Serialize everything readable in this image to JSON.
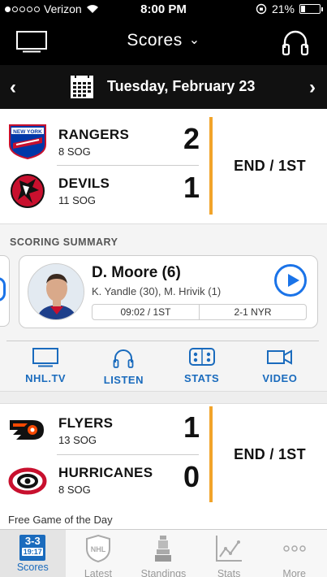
{
  "status_bar": {
    "carrier": "Verizon",
    "time": "8:00 PM",
    "battery": "21%",
    "battery_level": 0.21
  },
  "header": {
    "title": "Scores",
    "left_icon": "tv-icon",
    "right_icon": "headphones-icon"
  },
  "date_bar": {
    "date": "Tuesday, February 23",
    "prev_icon": "chevron-left-icon",
    "next_icon": "chevron-right-icon"
  },
  "games": [
    {
      "status": "END / 1ST",
      "teams": [
        {
          "name": "RANGERS",
          "sog": "8 SOG",
          "score": "2",
          "logo": "rangers-logo"
        },
        {
          "name": "DEVILS",
          "sog": "11 SOG",
          "score": "1",
          "logo": "devils-logo"
        }
      ]
    },
    {
      "status": "END / 1ST",
      "teams": [
        {
          "name": "FLYERS",
          "sog": "13 SOG",
          "score": "1",
          "logo": "flyers-logo"
        },
        {
          "name": "HURRICANES",
          "sog": "8 SOG",
          "score": "0",
          "logo": "hurricanes-logo"
        }
      ]
    }
  ],
  "scoring_summary": {
    "title": "SCORING SUMMARY",
    "goal": {
      "scorer": "D. Moore (6)",
      "assists": "K. Yandle (30), M. Hrivik (1)",
      "time": "09:02 / 1ST",
      "score": "2-1 NYR"
    }
  },
  "actions": [
    {
      "label": "NHL.TV",
      "icon": "tv-icon"
    },
    {
      "label": "LISTEN",
      "icon": "headphones-icon"
    },
    {
      "label": "STATS",
      "icon": "rink-icon"
    },
    {
      "label": "VIDEO",
      "icon": "video-camera-icon"
    }
  ],
  "free_game_text": "Free Game of the Day",
  "tabs": [
    {
      "label": "Scores",
      "badge_top": "3-3",
      "badge_bottom": "19:17",
      "active": true
    },
    {
      "label": "Latest",
      "icon": "nhl-shield-icon"
    },
    {
      "label": "Standings",
      "icon": "trophy-icon"
    },
    {
      "label": "Stats",
      "icon": "line-chart-icon"
    },
    {
      "label": "More",
      "icon": "more-dots-icon"
    }
  ],
  "colors": {
    "accent_blue": "#1a6bbd",
    "status_orange": "#f2a42a",
    "header_bg": "#000000"
  }
}
